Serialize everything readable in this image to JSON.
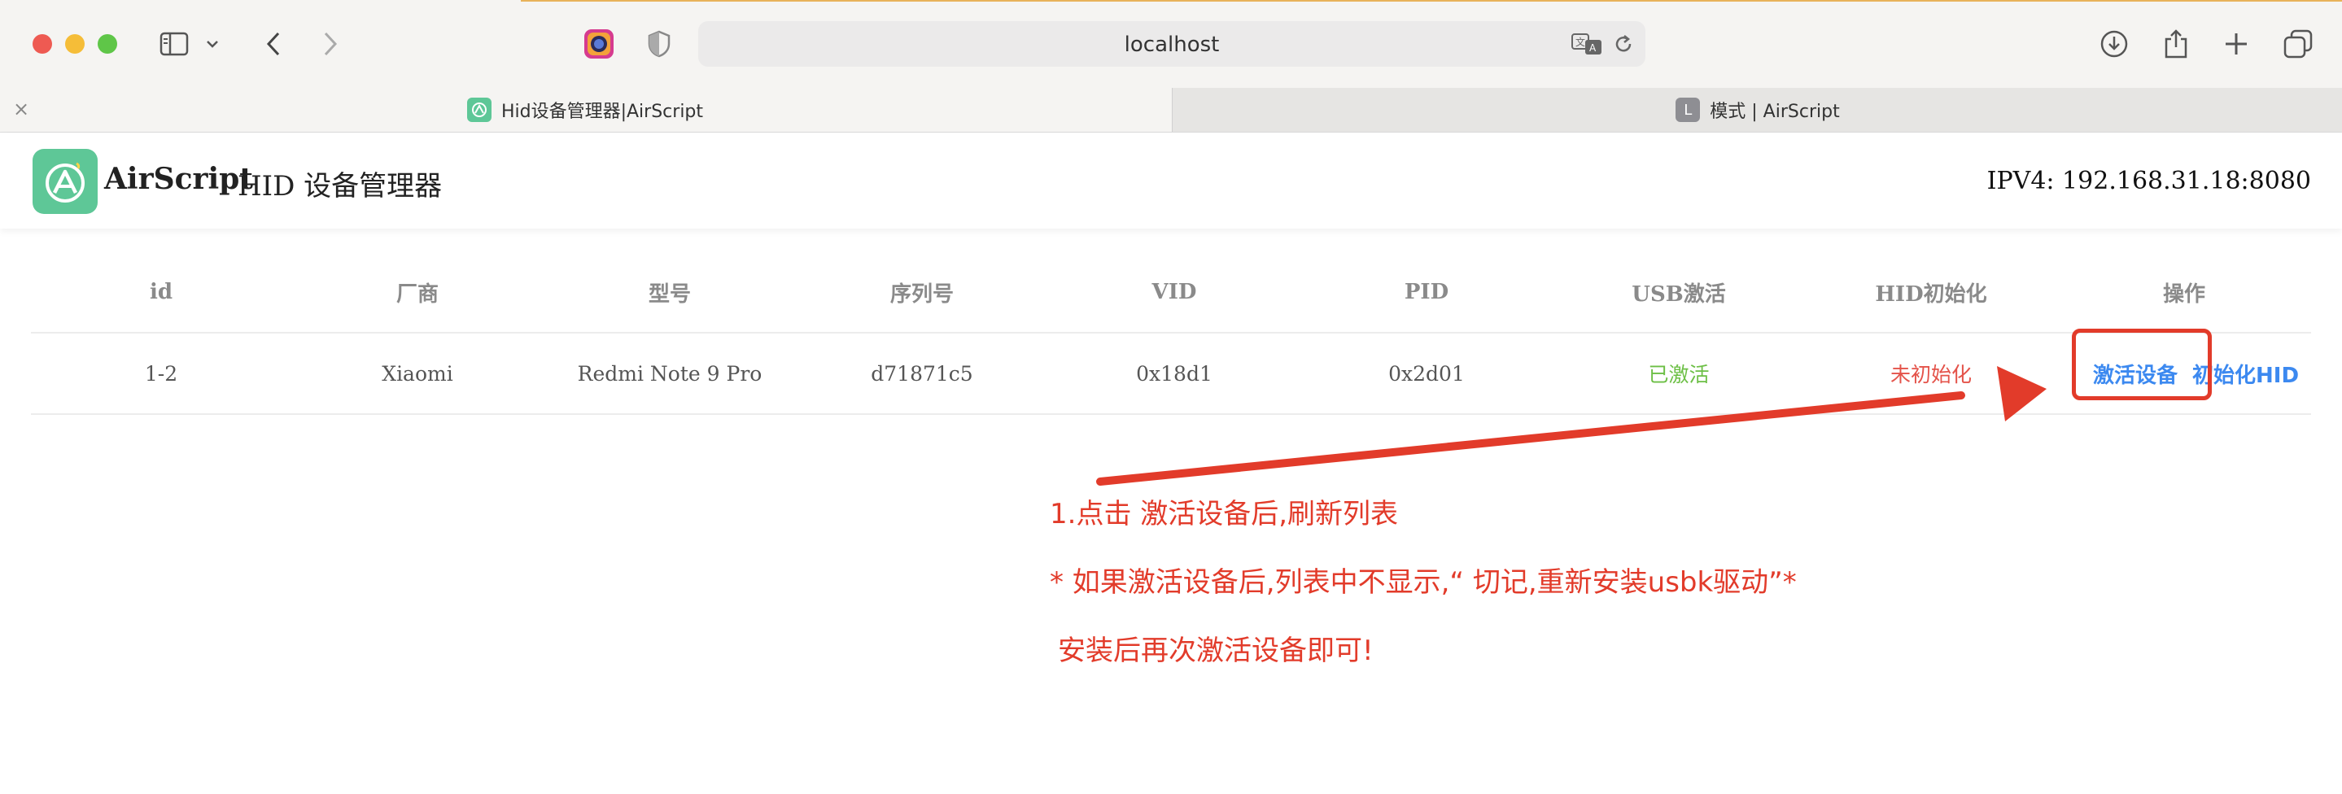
{
  "browser": {
    "url": "localhost",
    "tabs": [
      {
        "title": "Hid设备管理器|AirScript",
        "favicon": "airscript-logo"
      },
      {
        "title": "模式 | AirScript",
        "favicon": "L"
      }
    ]
  },
  "header": {
    "brand": "AirScript",
    "subtitle": "HID 设备管理器",
    "ip": "IPV4: 192.168.31.18:8080"
  },
  "table": {
    "columns": [
      "id",
      "厂商",
      "型号",
      "序列号",
      "VID",
      "PID",
      "USB激活",
      "HID初始化",
      "操作"
    ],
    "rows": [
      {
        "id": "1-2",
        "vendor": "Xiaomi",
        "model": "Redmi Note 9 Pro",
        "serial": "d71871c5",
        "vid": "0x18d1",
        "pid": "0x2d01",
        "usb_status": "已激活",
        "hid_status": "未初始化",
        "actions": [
          "激活设备",
          "初始化HID"
        ]
      }
    ]
  },
  "annotations": {
    "line1": "1.点击 激活设备后,刷新列表",
    "line2": "* 如果激活设备后,列表中不显示,“ 切记,重新安装usbk驱动”*",
    "line3": "安装后再次激活设备即可!"
  },
  "colors": {
    "accent_blue": "#3c89f0",
    "status_green": "#6cbf45",
    "status_red": "#e4534a",
    "annotation_red": "#e23b2a",
    "brand_green": "#5ec797"
  }
}
